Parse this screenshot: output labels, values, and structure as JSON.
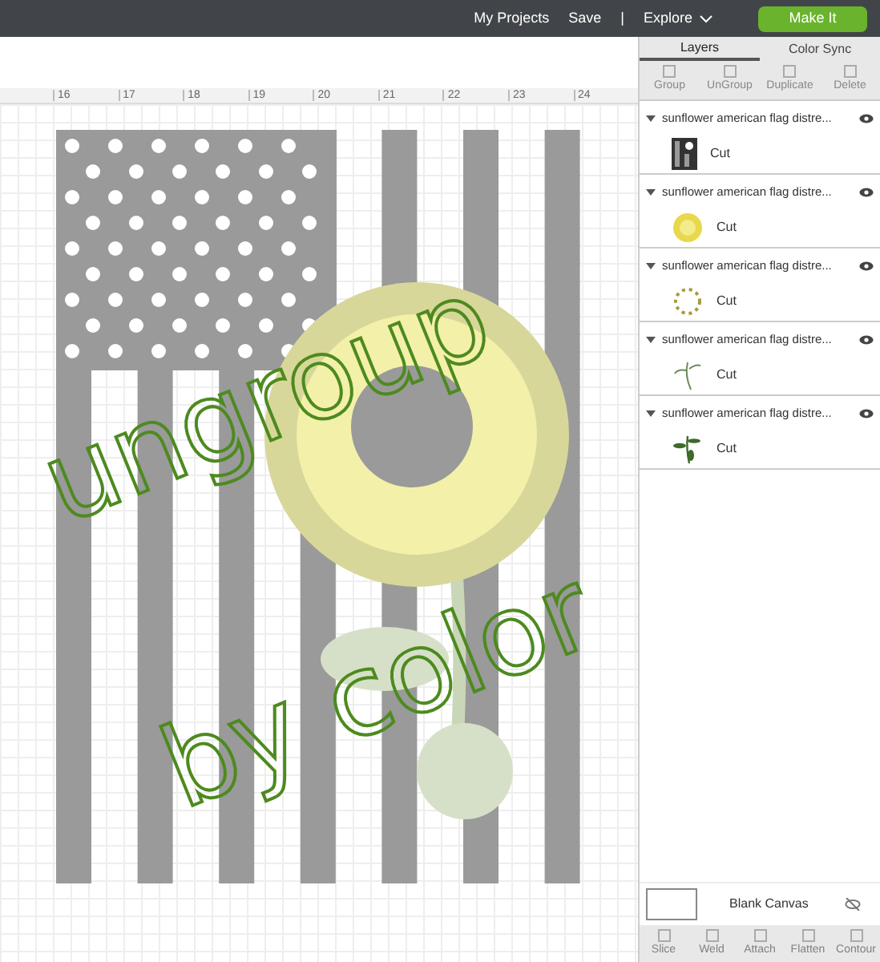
{
  "top_bar": {
    "links": [
      "My Projects",
      "Save",
      "|",
      "Explore"
    ],
    "make_button": "Make It"
  },
  "ruler": {
    "ticks": [
      "16",
      "17",
      "18",
      "19",
      "20",
      "21",
      "22",
      "23",
      "24"
    ]
  },
  "overlay_text": [
    "ungroup",
    "by color"
  ],
  "panel": {
    "tabs": [
      {
        "label": "Layers",
        "selected": true
      },
      {
        "label": "Color Sync",
        "selected": false
      }
    ],
    "toolbar": [
      "Group",
      "UnGroup",
      "Duplicate",
      "Delete"
    ],
    "layers": [
      {
        "name": "sunflower american flag distre...",
        "kind": "flag",
        "child": "Cut"
      },
      {
        "name": "sunflower american flag distre...",
        "kind": "flower",
        "child": "Cut"
      },
      {
        "name": "sunflower american flag distre...",
        "kind": "ring",
        "child": "Cut"
      },
      {
        "name": "sunflower american flag distre...",
        "kind": "stem",
        "child": "Cut"
      },
      {
        "name": "sunflower american flag distre...",
        "kind": "leaves",
        "child": "Cut"
      }
    ],
    "blank_canvas": "Blank Canvas",
    "bottom_toolbar": [
      "Slice",
      "Weld",
      "Attach",
      "Flatten",
      "Contour"
    ]
  }
}
